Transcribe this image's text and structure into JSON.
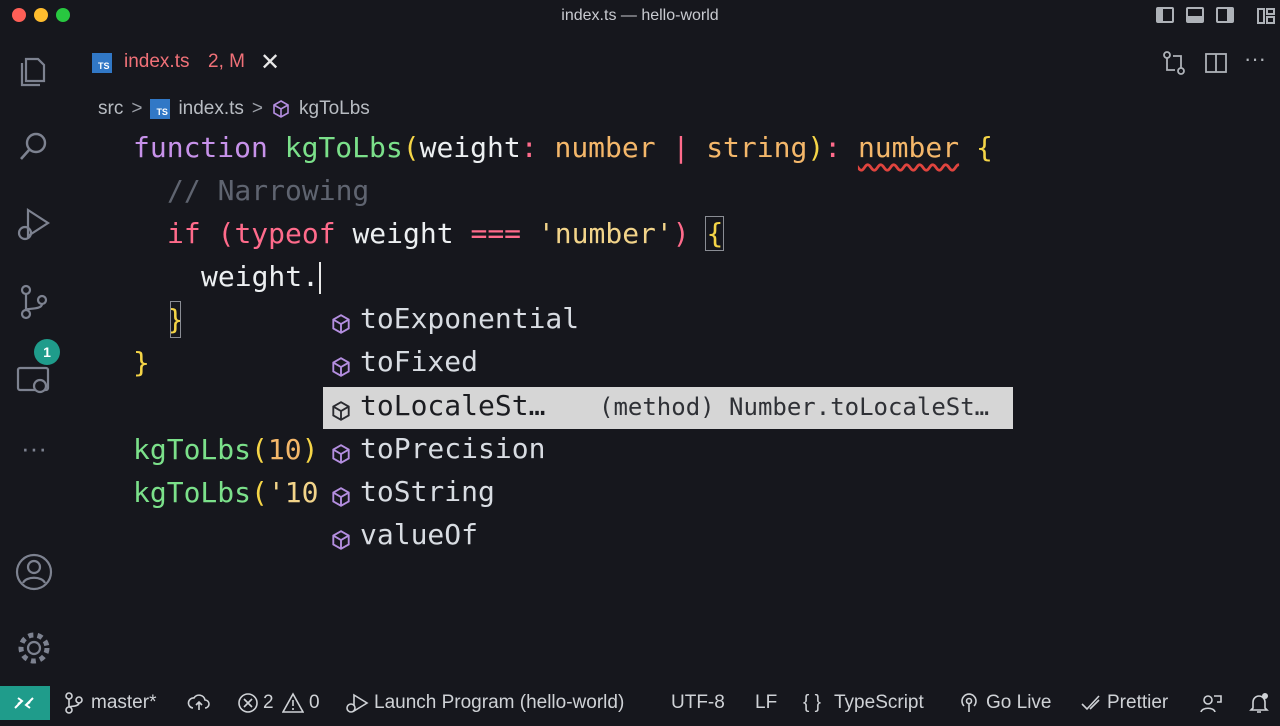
{
  "window": {
    "title": "index.ts — hello-world"
  },
  "tab": {
    "filename": "index.ts",
    "status": "2, M",
    "close": "✕"
  },
  "breadcrumb": {
    "folder": "src",
    "file": "index.ts",
    "symbol": "kgToLbs",
    "sep": ">"
  },
  "code": {
    "line1": {
      "kw": "function",
      "name": "kgToLbs",
      "open": "(",
      "param": "weight",
      "colon": ":",
      "t1": "number",
      "pipe": "|",
      "t2": "string",
      "close": ")",
      "colon2": ":",
      "ret": "number",
      "brace": "{"
    },
    "line2": {
      "comment": "// Narrowing"
    },
    "line3": {
      "kw": "if",
      "open": "(",
      "typeof": "typeof",
      "ident": "weight",
      "op": "===",
      "str": "'number'",
      "close": ")",
      "brace": "{"
    },
    "line4": {
      "text": "weight."
    },
    "line5": {
      "brace": "}"
    },
    "line6": {
      "brace": "}"
    },
    "line7": {
      "name": "kgToLbs",
      "open": "(",
      "arg": "10",
      "close": ")"
    },
    "line8": {
      "name": "kgToLbs",
      "open": "(",
      "arg": "'10"
    }
  },
  "suggestions": {
    "items": [
      {
        "label": "toExponential"
      },
      {
        "label": "toFixed"
      },
      {
        "label": "toLocaleSt…",
        "detail": "(method) Number.toLocaleSt…"
      },
      {
        "label": "toPrecision"
      },
      {
        "label": "toString"
      },
      {
        "label": "valueOf"
      }
    ],
    "selected_index": 2
  },
  "activity": {
    "scm_badge": "1"
  },
  "statusbar": {
    "branch": "master*",
    "errors": "2",
    "warnings": "0",
    "launch": "Launch Program (hello-world)",
    "encoding": "UTF-8",
    "eol": "LF",
    "language_braces": "{ }",
    "language": "TypeScript",
    "golive": "Go Live",
    "prettier": "Prettier"
  },
  "colors": {
    "accent": "#1f9c8b",
    "error": "#f07178",
    "ts": "#3178c6"
  }
}
